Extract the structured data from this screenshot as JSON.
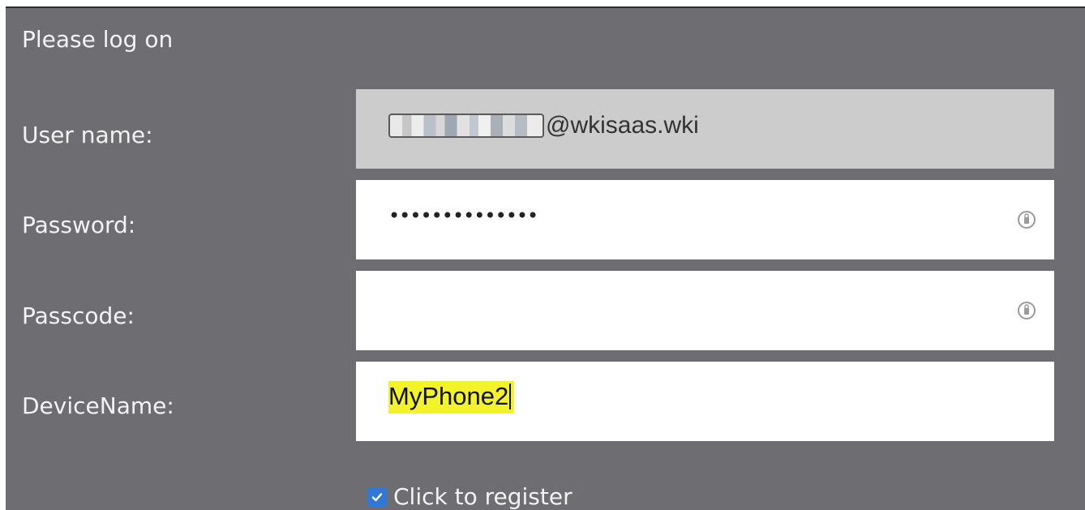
{
  "dialog": {
    "title": "Please log on"
  },
  "fields": {
    "username": {
      "label": "User name:",
      "value_suffix": "@wkisaas.wki"
    },
    "password": {
      "label": "Password:",
      "value_masked": "••••••••••••••",
      "icon": "credential-key-icon"
    },
    "passcode": {
      "label": "Passcode:",
      "value": "",
      "icon": "credential-key-icon"
    },
    "device_name": {
      "label": "DeviceName:",
      "value": "MyPhone2",
      "highlight_color": "#f3f32a"
    }
  },
  "register": {
    "label": "Click to register",
    "checked": true
  },
  "colors": {
    "panel_bg": "#6e6e72",
    "readonly_field_bg": "#cccccc",
    "checkbox_accent": "#2f78d6"
  }
}
